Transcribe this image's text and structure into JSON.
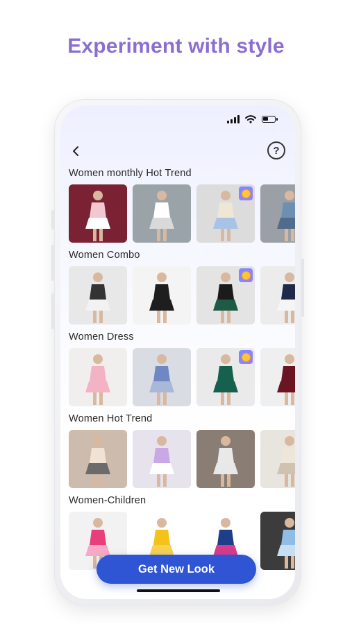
{
  "headline": "Experiment with style",
  "nav": {
    "back_icon": "chevron-left-icon",
    "help_label": "?"
  },
  "status": {
    "battery_level": 0.45
  },
  "sections": [
    {
      "title": "Women monthly Hot Trend",
      "items": [
        {
          "bg": "#7a2233",
          "figure": "#f3c7cf",
          "accent": "#ffffff",
          "premium": false
        },
        {
          "bg": "#9aa3a8",
          "figure": "#ffffff",
          "accent": "#d9d9d9",
          "premium": false
        },
        {
          "bg": "#dcdcdc",
          "figure": "#efe6d6",
          "accent": "#a9c3e6",
          "premium": true
        },
        {
          "bg": "#9aa0a6",
          "figure": "#6d8fb2",
          "accent": "#506b8c",
          "premium": false
        }
      ]
    },
    {
      "title": "Women Combo",
      "items": [
        {
          "bg": "#e8e8e8",
          "figure": "#333333",
          "accent": "#f2f2f2",
          "premium": false
        },
        {
          "bg": "#f4f4f4",
          "figure": "#1e1e1e",
          "accent": "#1e1e1e",
          "premium": false
        },
        {
          "bg": "#e4e4e4",
          "figure": "#1b1b1b",
          "accent": "#1f5a45",
          "premium": true
        },
        {
          "bg": "#ececec",
          "figure": "#1f2a4a",
          "accent": "#f5f5f5",
          "premium": false
        }
      ]
    },
    {
      "title": "Women Dress",
      "items": [
        {
          "bg": "#f1efee",
          "figure": "#f3b3c5",
          "accent": "#f3b3c5",
          "premium": false
        },
        {
          "bg": "#d9dde3",
          "figure": "#6f88c4",
          "accent": "#a9b8d9",
          "premium": false
        },
        {
          "bg": "#eaeaea",
          "figure": "#16614e",
          "accent": "#16614e",
          "premium": true
        },
        {
          "bg": "#efefef",
          "figure": "#6b1522",
          "accent": "#6b1522",
          "premium": false
        }
      ]
    },
    {
      "title": "Women Hot Trend",
      "items": [
        {
          "bg": "#cdbcae",
          "figure": "#f0e2d4",
          "accent": "#6b6b6b",
          "premium": false
        },
        {
          "bg": "#e6e3ec",
          "figure": "#c9a8e6",
          "accent": "#ffffff",
          "premium": false
        },
        {
          "bg": "#8a7d74",
          "figure": "#e9e9e9",
          "accent": "#e8e8e8",
          "premium": false
        },
        {
          "bg": "#e8e4de",
          "figure": "#efe6da",
          "accent": "#cfc2b1",
          "premium": false
        }
      ]
    },
    {
      "title": "Women-Children",
      "items": [
        {
          "bg": "#f2f2f2",
          "figure": "#e83f7c",
          "accent": "#f7a8c4",
          "premium": false
        },
        {
          "bg": "#ffffff",
          "figure": "#f5c21b",
          "accent": "#f7d24f",
          "premium": false
        },
        {
          "bg": "#ffffff",
          "figure": "#1f3e8a",
          "accent": "#d93a8a",
          "premium": false
        },
        {
          "bg": "#3c3c3c",
          "figure": "#8fbde6",
          "accent": "#c7ddf2",
          "premium": false
        }
      ]
    }
  ],
  "cta": {
    "label": "Get New Look"
  }
}
